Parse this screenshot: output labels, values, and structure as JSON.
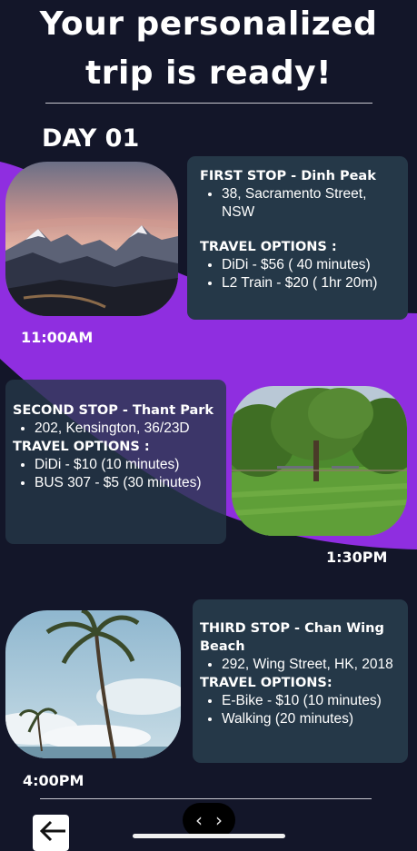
{
  "header": {
    "title_line1": "Your personalized",
    "title_line2": "trip is ready!"
  },
  "day_label": "DAY 01",
  "stops": [
    {
      "heading": "FIRST STOP - Dinh Peak",
      "address": "38, Sacramento Street, NSW",
      "travel_heading": "TRAVEL OPTIONS :",
      "options": [
        "DiDi - $56 ( 40 minutes)",
        "L2 Train - $20 ( 1hr 20m)"
      ],
      "time": "11:00AM",
      "photo": "mountain-photo"
    },
    {
      "heading": "SECOND STOP - Thant Park",
      "address": "202, Kensington, 36/23D",
      "travel_heading": "TRAVEL OPTIONS :",
      "options": [
        "DiDi - $10 (10 minutes)",
        "BUS 307 - $5 (30 minutes)"
      ],
      "time": "1:30PM",
      "photo": "park-photo"
    },
    {
      "heading": "THIRD STOP - Chan Wing Beach",
      "address": "292, Wing Street, HK, 2018",
      "travel_heading": "TRAVEL OPTIONS:",
      "options": [
        "E-Bike - $10 (10 minutes)",
        "Walking (20 minutes)"
      ],
      "time": "4:00PM",
      "photo": "beach-photo"
    }
  ],
  "nav": {
    "prev_glyph": "‹",
    "next_glyph": "›",
    "back_icon": "arrow-left-icon"
  },
  "colors": {
    "background": "#131629",
    "accent_purple": "#8f2ee0",
    "card": "#253848",
    "text": "#ffffff"
  }
}
